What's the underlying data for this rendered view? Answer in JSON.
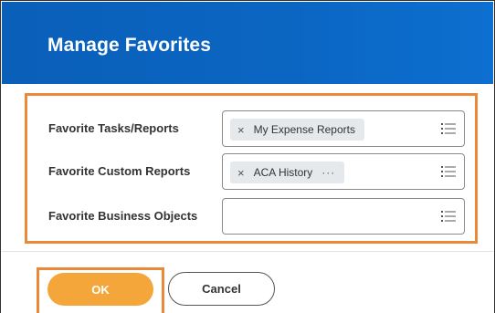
{
  "dialog": {
    "title": "Manage Favorites"
  },
  "form": {
    "rows": [
      {
        "label": "Favorite Tasks/Reports",
        "selected": [
          "My Expense Reports"
        ]
      },
      {
        "label": "Favorite Custom Reports",
        "selected": [
          "ACA History"
        ],
        "more_indicator": "···"
      },
      {
        "label": "Favorite Business Objects",
        "selected": []
      }
    ],
    "remove_glyph": "×"
  },
  "actions": {
    "ok_label": "OK",
    "cancel_label": "Cancel"
  },
  "colors": {
    "header_blue": "#0b66c3",
    "highlight_orange": "#e9893a",
    "ok_orange": "#f5a63a",
    "pill_gray": "#e6e9ec"
  },
  "icons": {
    "prompt": "list-prompt-icon",
    "remove": "close-icon"
  }
}
